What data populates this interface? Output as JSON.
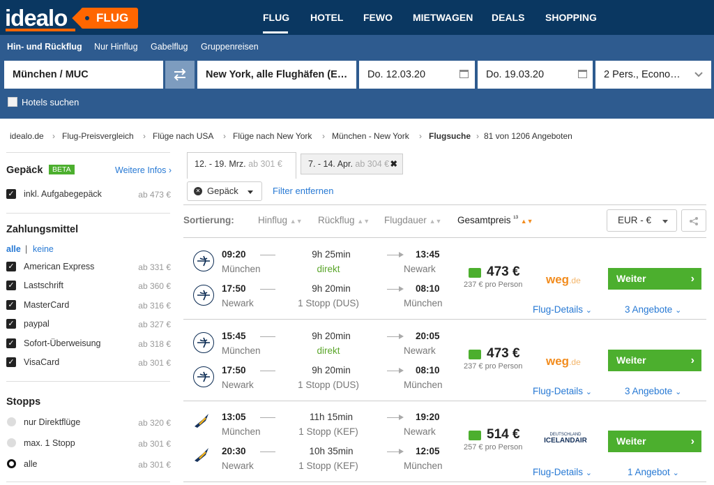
{
  "header": {
    "logo_text": "idealo",
    "product_badge": "FLUG",
    "nav": [
      "FLUG",
      "HOTEL",
      "FEWO",
      "MIETWAGEN",
      "DEALS",
      "SHOPPING"
    ]
  },
  "search": {
    "trip_types": [
      "Hin- und Rückflug",
      "Nur Hinflug",
      "Gabelflug",
      "Gruppenreisen"
    ],
    "origin": "München / MUC",
    "destination": "New York, alle Flughäfen (E…",
    "depart_date": "Do. 12.03.20",
    "return_date": "Do. 19.03.20",
    "passengers": "2 Pers., Econo…",
    "hotels_label": "Hotels suchen"
  },
  "breadcrumb": {
    "items": [
      "idealo.de",
      "Flug-Preisvergleich",
      "Flüge nach USA",
      "Flüge nach New York",
      "München - New York"
    ],
    "current": "Flugsuche",
    "count": "81 von 1206 Angeboten"
  },
  "filters": {
    "baggage": {
      "title": "Gepäck",
      "badge": "BETA",
      "more": "Weitere Infos ›",
      "option": "inkl. Aufgabegepäck",
      "option_price": "ab 473 €"
    },
    "payment": {
      "title": "Zahlungsmittel",
      "all": "alle",
      "sep": "|",
      "none": "keine",
      "options": [
        {
          "label": "American Express",
          "price": "ab 331 €"
        },
        {
          "label": "Lastschrift",
          "price": "ab 360 €"
        },
        {
          "label": "MasterCard",
          "price": "ab 316 €"
        },
        {
          "label": "paypal",
          "price": "ab 327 €"
        },
        {
          "label": "Sofort-Überweisung",
          "price": "ab 318 €"
        },
        {
          "label": "VisaCard",
          "price": "ab 301 €"
        }
      ]
    },
    "stops": {
      "title": "Stopps",
      "options": [
        {
          "label": "nur Direktflüge",
          "price": "ab 320 €"
        },
        {
          "label": "max. 1 Stopp",
          "price": "ab 301 €"
        },
        {
          "label": "alle",
          "price": "ab 301 €"
        }
      ]
    }
  },
  "tabs": [
    {
      "label": "12. - 19. Mrz.",
      "price": "ab 301 €"
    },
    {
      "label": "7. - 14. Apr.",
      "price": "ab 304 €"
    }
  ],
  "active_filter": {
    "chip": "Gepäck",
    "remove": "Filter entfernen"
  },
  "sorting": {
    "label": "Sortierung:",
    "hin": "Hinflug",
    "rueck": "Rückflug",
    "dauer": "Flugdauer",
    "gesamt": "Gesamtpreis",
    "gesamt_sup": "¹³",
    "currency": "EUR - €"
  },
  "results": [
    {
      "legs": [
        {
          "dep": "09:20",
          "from": "München",
          "dur": "9h 25min",
          "stops": "direkt",
          "arr": "13:45",
          "to": "Newark"
        },
        {
          "dep": "17:50",
          "from": "Newark",
          "dur": "9h 20min",
          "stops": "1 Stopp (DUS)",
          "arr": "08:10",
          "to": "München"
        }
      ],
      "airline": "lufthansa-logo",
      "price": "473 €",
      "per_person": "237 € pro Person",
      "provider": "weg",
      "provider_tld": ".de",
      "cta": "Weiter",
      "details": "Flug-Details",
      "offers": "3 Angebote"
    },
    {
      "legs": [
        {
          "dep": "15:45",
          "from": "München",
          "dur": "9h 20min",
          "stops": "direkt",
          "arr": "20:05",
          "to": "Newark"
        },
        {
          "dep": "17:50",
          "from": "Newark",
          "dur": "9h 20min",
          "stops": "1 Stopp (DUS)",
          "arr": "08:10",
          "to": "München"
        }
      ],
      "airline": "lufthansa-logo",
      "price": "473 €",
      "per_person": "237 € pro Person",
      "provider": "weg",
      "provider_tld": ".de",
      "cta": "Weiter",
      "details": "Flug-Details",
      "offers": "3 Angebote"
    },
    {
      "legs": [
        {
          "dep": "13:05",
          "from": "München",
          "dur": "11h 15min",
          "stops": "1 Stopp (KEF)",
          "arr": "19:20",
          "to": "Newark"
        },
        {
          "dep": "20:30",
          "from": "Newark",
          "dur": "10h 35min",
          "stops": "1 Stopp (KEF)",
          "arr": "12:05",
          "to": "München"
        }
      ],
      "airline": "icelandair-logo",
      "price": "514 €",
      "per_person": "257 € pro Person",
      "provider": "ICELANDAIR",
      "provider_small": "DEUTSCHLAND",
      "cta": "Weiter",
      "details": "Flug-Details",
      "offers": "1 Angebot"
    }
  ],
  "colors": {
    "navy": "#0a3761",
    "panel": "#2e5b8f",
    "orange": "#ff6600",
    "green": "#4caf2e",
    "link": "#2779d4"
  }
}
